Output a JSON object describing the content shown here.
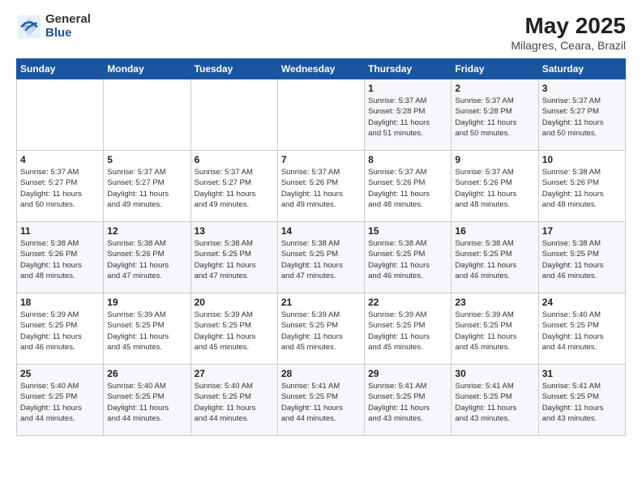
{
  "header": {
    "logo_general": "General",
    "logo_blue": "Blue",
    "month_year": "May 2025",
    "location": "Milagres, Ceara, Brazil"
  },
  "weekdays": [
    "Sunday",
    "Monday",
    "Tuesday",
    "Wednesday",
    "Thursday",
    "Friday",
    "Saturday"
  ],
  "weeks": [
    [
      {
        "day": "",
        "info": ""
      },
      {
        "day": "",
        "info": ""
      },
      {
        "day": "",
        "info": ""
      },
      {
        "day": "",
        "info": ""
      },
      {
        "day": "1",
        "info": "Sunrise: 5:37 AM\nSunset: 5:28 PM\nDaylight: 11 hours\nand 51 minutes."
      },
      {
        "day": "2",
        "info": "Sunrise: 5:37 AM\nSunset: 5:28 PM\nDaylight: 11 hours\nand 50 minutes."
      },
      {
        "day": "3",
        "info": "Sunrise: 5:37 AM\nSunset: 5:27 PM\nDaylight: 11 hours\nand 50 minutes."
      }
    ],
    [
      {
        "day": "4",
        "info": "Sunrise: 5:37 AM\nSunset: 5:27 PM\nDaylight: 11 hours\nand 50 minutes."
      },
      {
        "day": "5",
        "info": "Sunrise: 5:37 AM\nSunset: 5:27 PM\nDaylight: 11 hours\nand 49 minutes."
      },
      {
        "day": "6",
        "info": "Sunrise: 5:37 AM\nSunset: 5:27 PM\nDaylight: 11 hours\nand 49 minutes."
      },
      {
        "day": "7",
        "info": "Sunrise: 5:37 AM\nSunset: 5:26 PM\nDaylight: 11 hours\nand 49 minutes."
      },
      {
        "day": "8",
        "info": "Sunrise: 5:37 AM\nSunset: 5:26 PM\nDaylight: 11 hours\nand 48 minutes."
      },
      {
        "day": "9",
        "info": "Sunrise: 5:37 AM\nSunset: 5:26 PM\nDaylight: 11 hours\nand 48 minutes."
      },
      {
        "day": "10",
        "info": "Sunrise: 5:38 AM\nSunset: 5:26 PM\nDaylight: 11 hours\nand 48 minutes."
      }
    ],
    [
      {
        "day": "11",
        "info": "Sunrise: 5:38 AM\nSunset: 5:26 PM\nDaylight: 11 hours\nand 48 minutes."
      },
      {
        "day": "12",
        "info": "Sunrise: 5:38 AM\nSunset: 5:26 PM\nDaylight: 11 hours\nand 47 minutes."
      },
      {
        "day": "13",
        "info": "Sunrise: 5:38 AM\nSunset: 5:25 PM\nDaylight: 11 hours\nand 47 minutes."
      },
      {
        "day": "14",
        "info": "Sunrise: 5:38 AM\nSunset: 5:25 PM\nDaylight: 11 hours\nand 47 minutes."
      },
      {
        "day": "15",
        "info": "Sunrise: 5:38 AM\nSunset: 5:25 PM\nDaylight: 11 hours\nand 46 minutes."
      },
      {
        "day": "16",
        "info": "Sunrise: 5:38 AM\nSunset: 5:25 PM\nDaylight: 11 hours\nand 46 minutes."
      },
      {
        "day": "17",
        "info": "Sunrise: 5:38 AM\nSunset: 5:25 PM\nDaylight: 11 hours\nand 46 minutes."
      }
    ],
    [
      {
        "day": "18",
        "info": "Sunrise: 5:39 AM\nSunset: 5:25 PM\nDaylight: 11 hours\nand 46 minutes."
      },
      {
        "day": "19",
        "info": "Sunrise: 5:39 AM\nSunset: 5:25 PM\nDaylight: 11 hours\nand 45 minutes."
      },
      {
        "day": "20",
        "info": "Sunrise: 5:39 AM\nSunset: 5:25 PM\nDaylight: 11 hours\nand 45 minutes."
      },
      {
        "day": "21",
        "info": "Sunrise: 5:39 AM\nSunset: 5:25 PM\nDaylight: 11 hours\nand 45 minutes."
      },
      {
        "day": "22",
        "info": "Sunrise: 5:39 AM\nSunset: 5:25 PM\nDaylight: 11 hours\nand 45 minutes."
      },
      {
        "day": "23",
        "info": "Sunrise: 5:39 AM\nSunset: 5:25 PM\nDaylight: 11 hours\nand 45 minutes."
      },
      {
        "day": "24",
        "info": "Sunrise: 5:40 AM\nSunset: 5:25 PM\nDaylight: 11 hours\nand 44 minutes."
      }
    ],
    [
      {
        "day": "25",
        "info": "Sunrise: 5:40 AM\nSunset: 5:25 PM\nDaylight: 11 hours\nand 44 minutes."
      },
      {
        "day": "26",
        "info": "Sunrise: 5:40 AM\nSunset: 5:25 PM\nDaylight: 11 hours\nand 44 minutes."
      },
      {
        "day": "27",
        "info": "Sunrise: 5:40 AM\nSunset: 5:25 PM\nDaylight: 11 hours\nand 44 minutes."
      },
      {
        "day": "28",
        "info": "Sunrise: 5:41 AM\nSunset: 5:25 PM\nDaylight: 11 hours\nand 44 minutes."
      },
      {
        "day": "29",
        "info": "Sunrise: 5:41 AM\nSunset: 5:25 PM\nDaylight: 11 hours\nand 43 minutes."
      },
      {
        "day": "30",
        "info": "Sunrise: 5:41 AM\nSunset: 5:25 PM\nDaylight: 11 hours\nand 43 minutes."
      },
      {
        "day": "31",
        "info": "Sunrise: 5:41 AM\nSunset: 5:25 PM\nDaylight: 11 hours\nand 43 minutes."
      }
    ]
  ]
}
